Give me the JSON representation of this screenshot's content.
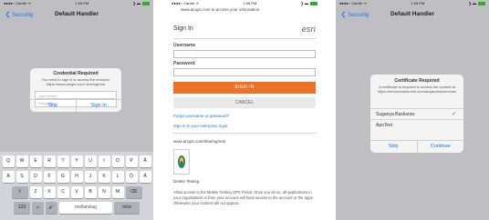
{
  "left_screen": {
    "status": {
      "left": "●●●●○ Carrier ᯤ",
      "center": "1:06 PM",
      "right": "❯ ▬"
    },
    "nav": {
      "back_label": "Security",
      "title": "Default Handler"
    },
    "dialog": {
      "title": "Credential Required",
      "message": "You need to sign in to access the resource https://www.arcgis.com/ sharing/rest",
      "username_placeholder": "User Name",
      "password_placeholder": "Password",
      "cancel_label": "Skip",
      "signin_label": "Sign In"
    },
    "keyboard": {
      "row1": [
        "Q",
        "W",
        "E",
        "R",
        "T",
        "Y",
        "U",
        "I",
        "O",
        "P",
        "Å"
      ],
      "row2": [
        "A",
        "S",
        "D",
        "F",
        "G",
        "H",
        "J",
        "K",
        "L",
        "Ö",
        "Ä"
      ],
      "row3": [
        "Z",
        "X",
        "C",
        "V",
        "B",
        "N",
        "M"
      ],
      "shift": "⇧",
      "backspace": "⌫",
      "numbers": "123",
      "emoji": "☺",
      "mic": "🎤",
      "space": "mellanslag",
      "return": "retur"
    }
  },
  "middle_screen": {
    "status": {
      "left": "●●●●○ Carrier ᯤ",
      "center": "1:06 PM",
      "right": "❯ ▬"
    },
    "header_text": "www.arcgis.com to access your information",
    "signin_title": "Sign In",
    "brand": "esri",
    "username_label": "Username",
    "password_label": "Password",
    "signin_button": "SIGN IN",
    "cancel_button": "CANCEL",
    "forgot_link": "Forgot username or password?",
    "enterprise_link": "Sign in to your enterprise login",
    "domain_text": "www.arcgis.com/sharing/rest",
    "app_name": "Delete Testing",
    "description": "Allow access to the Mobile Testing OPS Portal. Once you do so, all applications in your organization or from your account will have access to the account or the apps. Otherwise your content will not appear..."
  },
  "right_screen": {
    "status": {
      "left": "●●●●○ Carrier ᯤ",
      "center": "1:06 PM",
      "right": "❯ ▬"
    },
    "nav": {
      "back_label": "Security",
      "title": "Default Handler"
    },
    "dialog": {
      "title": "Certificate Required",
      "message": "A certificate is required to access the content at https://servicesbeta.esri.com/arcgis/rest/services",
      "items": [
        {
          "label": "Suganya Baskaran",
          "selected": true
        },
        {
          "label": "ApoTest",
          "selected": false
        }
      ],
      "cancel_label": "Skip",
      "continue_label": "Continue"
    }
  },
  "colors": {
    "ios_blue": "#1a73e8",
    "esri_orange": "#e8722a",
    "dim_background": "#bfbfc3",
    "keyboard_bg": "#d1d4d9"
  }
}
